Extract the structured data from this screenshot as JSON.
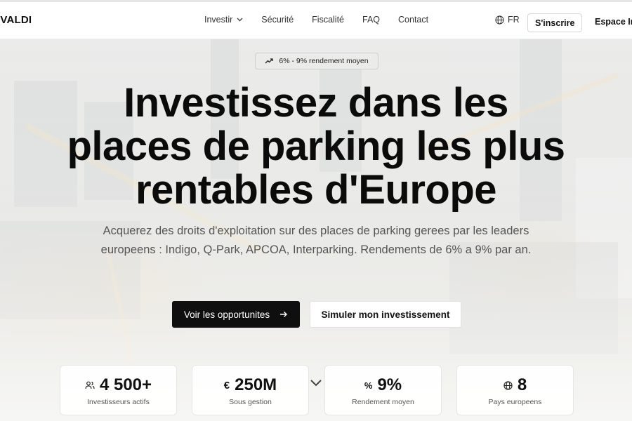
{
  "nav": {
    "logo": "IVALDI",
    "menu": [
      {
        "label": "Investir",
        "has_dropdown": true
      },
      {
        "label": "Sécurité"
      },
      {
        "label": "Fiscalité"
      },
      {
        "label": "FAQ"
      },
      {
        "label": "Contact"
      }
    ],
    "language": "FR",
    "signup_label": "S'inscrire",
    "investor_space_label": "Espace In"
  },
  "hero": {
    "badge": "6% - 9% rendement moyen",
    "headline": "Investissez dans les places de parking les plus rentables d'Europe",
    "subtitle": "Acquerez des droits d'exploitation sur des places de parking gerees par les leaders europeens : Indigo, Q-Park, APCOA, Interparking. Rendements de 6% a 9% par an.",
    "primary_button": "Voir les opportunites",
    "secondary_button": "Simuler mon investissement"
  },
  "stats": [
    {
      "icon": "users-icon",
      "value": "4 500+",
      "label": "Investisseurs actifs"
    },
    {
      "icon": "euro-icon",
      "value": "250M",
      "label": "Sous gestion"
    },
    {
      "icon": "percent-icon",
      "value": "9%",
      "label": "Rendement moyen"
    },
    {
      "icon": "globe-icon",
      "value": "8",
      "label": "Pays europeens"
    }
  ],
  "colors": {
    "primary": "#0f0f0f",
    "background": "#f5f5f3",
    "text_muted": "#555555"
  }
}
